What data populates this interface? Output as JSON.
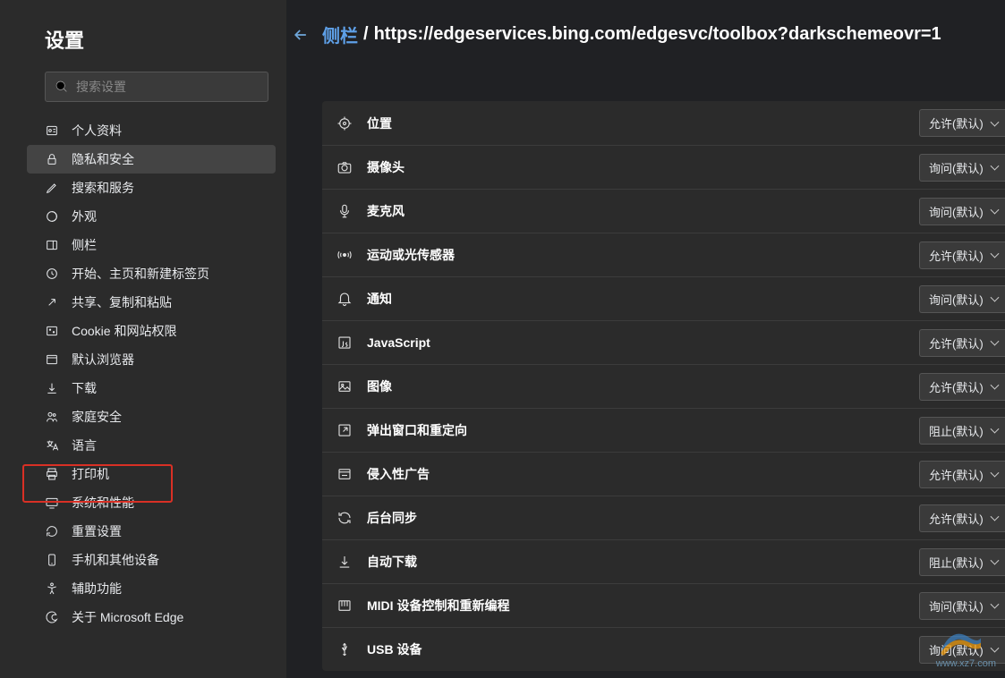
{
  "sidebar": {
    "title": "设置",
    "search_placeholder": "搜索设置",
    "items": [
      {
        "label": "个人资料",
        "icon": "profile"
      },
      {
        "label": "隐私和安全",
        "icon": "lock",
        "selected": true
      },
      {
        "label": "搜索和服务",
        "icon": "pencil"
      },
      {
        "label": "外观",
        "icon": "appearance"
      },
      {
        "label": "侧栏",
        "icon": "sidebar"
      },
      {
        "label": "开始、主页和新建标签页",
        "icon": "home"
      },
      {
        "label": "共享、复制和粘贴",
        "icon": "share"
      },
      {
        "label": "Cookie 和网站权限",
        "icon": "cookie"
      },
      {
        "label": "默认浏览器",
        "icon": "browser"
      },
      {
        "label": "下载",
        "icon": "download"
      },
      {
        "label": "家庭安全",
        "icon": "family"
      },
      {
        "label": "语言",
        "icon": "language"
      },
      {
        "label": "打印机",
        "icon": "printer"
      },
      {
        "label": "系统和性能",
        "icon": "system",
        "highlighted": true
      },
      {
        "label": "重置设置",
        "icon": "reset"
      },
      {
        "label": "手机和其他设备",
        "icon": "phone"
      },
      {
        "label": "辅助功能",
        "icon": "accessibility"
      },
      {
        "label": "关于 Microsoft Edge",
        "icon": "edge"
      }
    ]
  },
  "breadcrumb": {
    "link": "侧栏",
    "url": "https://edgeservices.bing.com/edgesvc/toolbox?darkschemeovr=1"
  },
  "permissions": [
    {
      "label": "位置",
      "value": "允许(默认)",
      "icon": "location"
    },
    {
      "label": "摄像头",
      "value": "询问(默认)",
      "icon": "camera"
    },
    {
      "label": "麦克风",
      "value": "询问(默认)",
      "icon": "mic"
    },
    {
      "label": "运动或光传感器",
      "value": "允许(默认)",
      "icon": "sensor"
    },
    {
      "label": "通知",
      "value": "询问(默认)",
      "icon": "bell"
    },
    {
      "label": "JavaScript",
      "value": "允许(默认)",
      "icon": "js"
    },
    {
      "label": "图像",
      "value": "允许(默认)",
      "icon": "image"
    },
    {
      "label": "弹出窗口和重定向",
      "value": "阻止(默认)",
      "icon": "popup"
    },
    {
      "label": "侵入性广告",
      "value": "允许(默认)",
      "icon": "ads"
    },
    {
      "label": "后台同步",
      "value": "允许(默认)",
      "icon": "sync"
    },
    {
      "label": "自动下载",
      "value": "阻止(默认)",
      "icon": "download"
    },
    {
      "label": "MIDI 设备控制和重新编程",
      "value": "询问(默认)",
      "icon": "midi"
    },
    {
      "label": "USB 设备",
      "value": "询问(默认)",
      "icon": "usb"
    }
  ],
  "watermark": "www.xz7.com"
}
